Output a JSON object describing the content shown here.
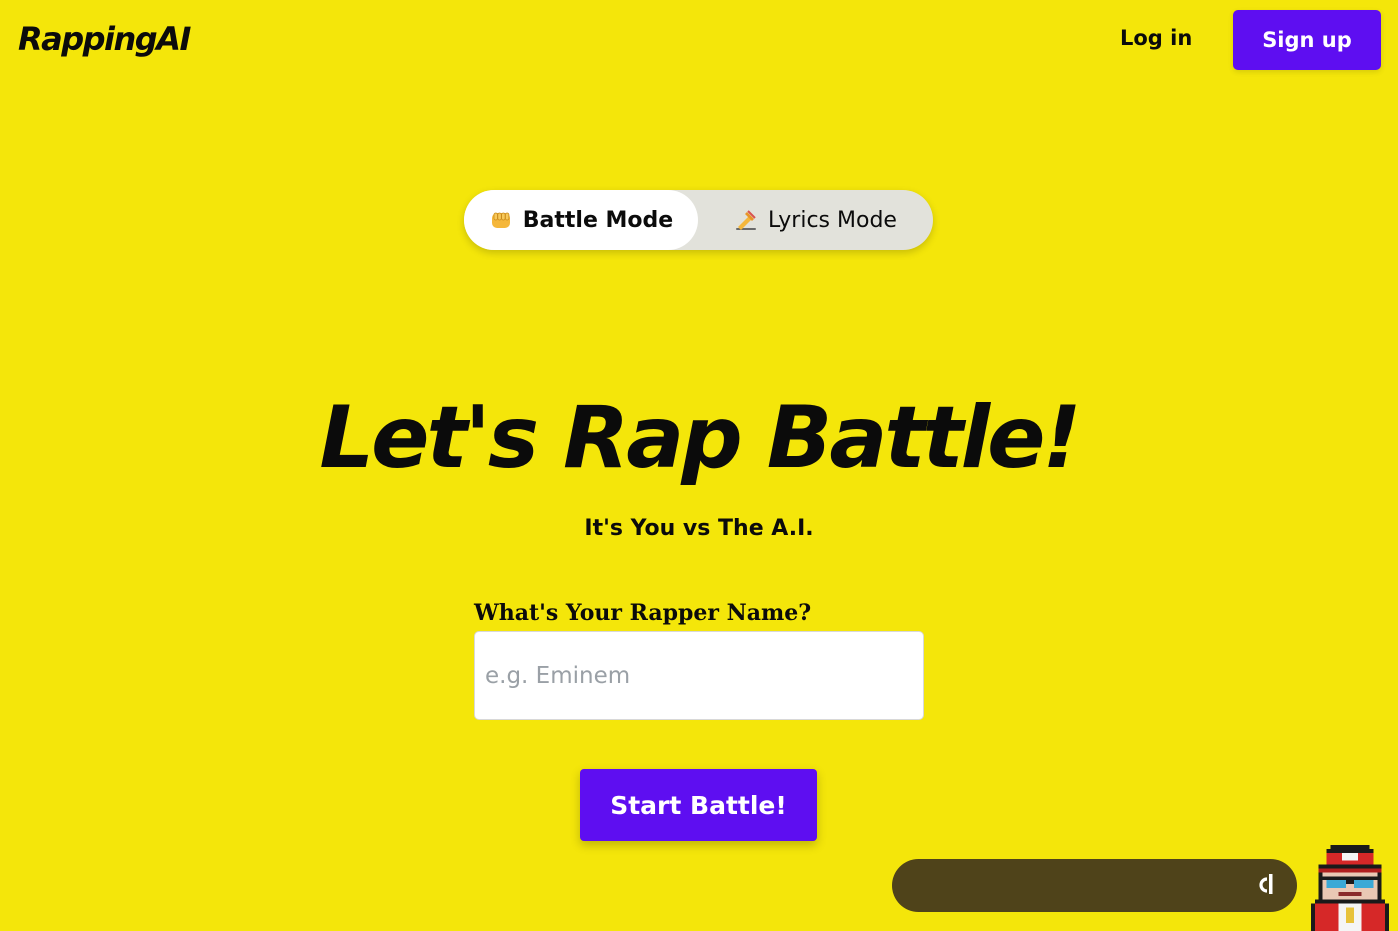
{
  "header": {
    "logo": "RappingAI",
    "login_label": "Log in",
    "signup_label": "Sign up"
  },
  "modes": {
    "battle_label": "Battle Mode",
    "battle_icon": "fist-bump-icon",
    "lyrics_label": "Lyrics Mode",
    "lyrics_icon": "writing-hand-icon",
    "selected": "Battle Mode"
  },
  "hero": {
    "title": "Let's Rap Battle!",
    "subtitle": "It's You vs The A.I."
  },
  "form": {
    "name_label": "What's Your Rapper Name?",
    "name_placeholder": "e.g. Eminem",
    "name_value": "",
    "submit_label": "Start Battle!"
  },
  "widget": {
    "chat_icon": "chat-logo-icon",
    "mascot_icon": "pixel-rapper-mascot-icon"
  },
  "colors": {
    "background": "#F4E60A",
    "accent": "#5E0EF1",
    "text": "#0b0b0b",
    "chat_bar": "#4F431A"
  }
}
